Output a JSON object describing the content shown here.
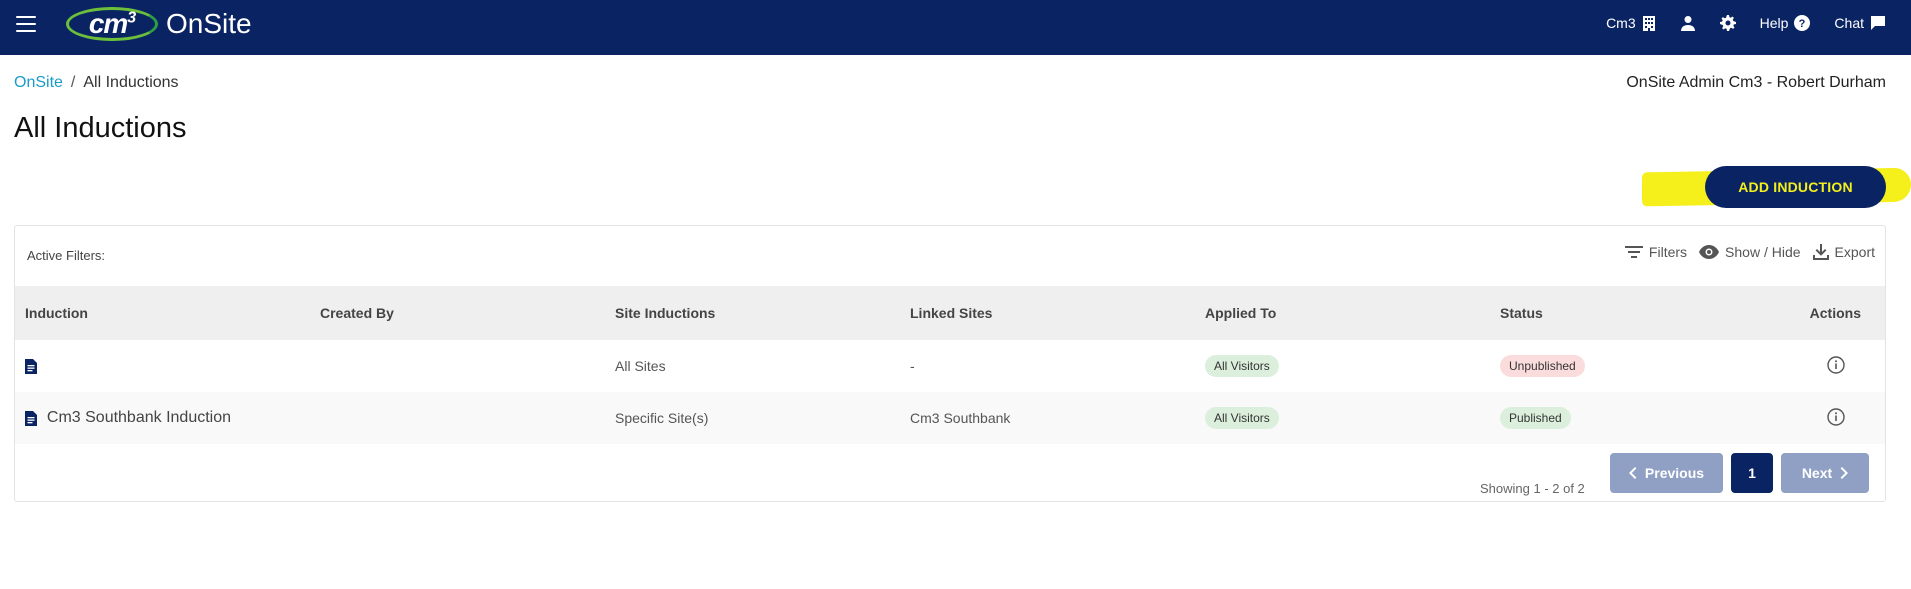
{
  "colors": {
    "navy": "#0a2463",
    "accent_link": "#1a9bc9",
    "highlight": "#f5ef1b",
    "disabled_btn": "#8fa0c4"
  },
  "topbar": {
    "menu_icon": "hamburger-icon",
    "logo_mark": "cm",
    "logo_sup": "3",
    "logo_text": "OnSite",
    "company": "Cm3",
    "company_icon": "building-icon",
    "profile_icon": "person-icon",
    "settings_icon": "gear-icon",
    "help": "Help",
    "help_icon": "question-circle-icon",
    "chat": "Chat",
    "chat_icon": "chat-bubble-icon"
  },
  "breadcrumb": {
    "root": "OnSite",
    "sep": "/",
    "current": "All Inductions"
  },
  "user": {
    "name": "OnSite Admin Cm3 - Robert Durham"
  },
  "page": {
    "title": "All Inductions",
    "add_button": "ADD INDUCTION"
  },
  "toolbar": {
    "active_filters": "Active Filters:",
    "filters": "Filters",
    "show_hide": "Show / Hide",
    "export": "Export"
  },
  "table": {
    "headers": [
      "Induction",
      "Created By",
      "Site Inductions",
      "Linked Sites",
      "Applied To",
      "Status",
      "Actions"
    ],
    "rows": [
      {
        "induction": "",
        "created_by": "",
        "site_inductions": "All Sites",
        "linked_sites": "-",
        "applied_to": "All Visitors",
        "status": "Unpublished"
      },
      {
        "induction": "Cm3 Southbank Induction",
        "created_by": "",
        "site_inductions": "Specific Site(s)",
        "linked_sites": "Cm3 Southbank",
        "applied_to": "All Visitors",
        "status": "Published"
      }
    ]
  },
  "pagination": {
    "showing": "Showing 1 - 2 of 2",
    "previous": "Previous",
    "page": "1",
    "next": "Next"
  }
}
